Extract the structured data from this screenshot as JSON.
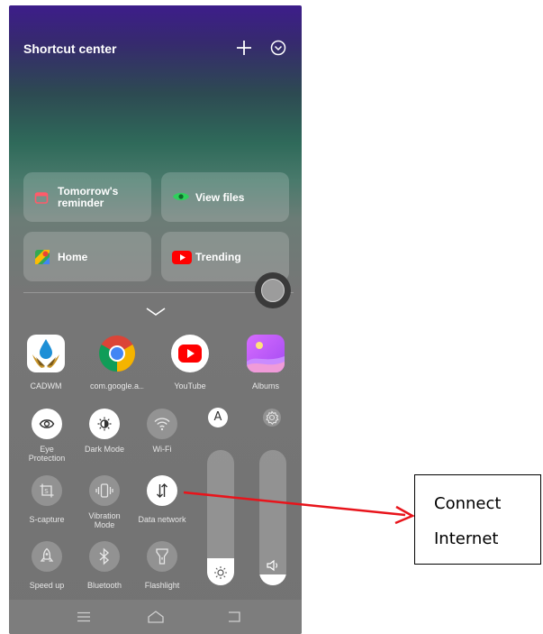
{
  "header": {
    "title": "Shortcut center"
  },
  "shortcut_cards": [
    {
      "label": "Tomorrow's reminder",
      "line1": "Tomorrow's",
      "line2": "reminder",
      "icon": "calendar-icon"
    },
    {
      "label": "View files",
      "icon": "eye-icon"
    },
    {
      "label": "Home",
      "icon": "maps-icon"
    },
    {
      "label": "Trending",
      "icon": "youtube-icon"
    }
  ],
  "apps": [
    {
      "label": "CADWM",
      "icon": "cadwm-icon"
    },
    {
      "label": "com.google.a...",
      "icon": "chrome-icon"
    },
    {
      "label": "YouTube",
      "icon": "youtube-icon"
    },
    {
      "label": "Albums",
      "icon": "albums-icon"
    }
  ],
  "toggles": [
    {
      "line1": "Eye",
      "line2": "Protection",
      "state": "on"
    },
    {
      "label": "Dark Mode",
      "state": "on"
    },
    {
      "label": "Wi-Fi",
      "state": "off"
    },
    {
      "label": "S-capture",
      "state": "off"
    },
    {
      "line1": "Vibration",
      "line2": "Mode",
      "state": "off"
    },
    {
      "label": "Data network",
      "state": "on"
    },
    {
      "label": "Speed up",
      "state": "off"
    },
    {
      "label": "Bluetooth",
      "state": "off"
    },
    {
      "label": "Flashlight",
      "state": "off"
    }
  ],
  "auto_brightness_letter": "A",
  "sliders": {
    "brightness": {
      "level": 0.2,
      "icon": "sun-icon"
    },
    "volume": {
      "level": 0.08,
      "icon": "speaker-icon"
    }
  },
  "annotation": {
    "line1": "Connect",
    "line2": "Internet",
    "arrow_color": "#e8141b"
  }
}
